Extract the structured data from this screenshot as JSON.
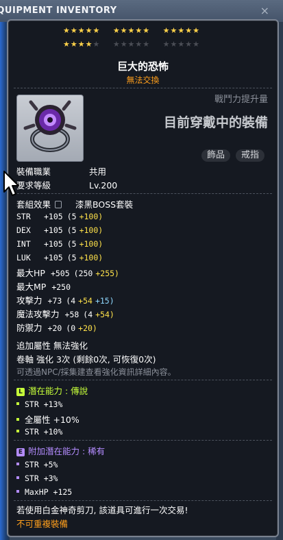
{
  "window": {
    "title": "EQUIPMENT INVENTORY",
    "close_glyph": "×"
  },
  "stars": {
    "row1": [
      "★★★★★",
      "★★★★★",
      "★★★★★"
    ],
    "row2_on": "★★★★",
    "row2_off": [
      "★",
      "★★★★★",
      "★★★★★"
    ]
  },
  "item": {
    "name": "巨大的恐怖",
    "trade_status": "無法交換",
    "icon": "ring-icon",
    "power_label": "戰鬥力提升量",
    "equipped_label": "目前穿戴中的裝備",
    "tags": [
      "飾品",
      "戒指"
    ]
  },
  "requirements": {
    "job_label": "裝備職業",
    "job_value": "共用",
    "level_label": "要求等級",
    "level_value": "Lv.200"
  },
  "set": {
    "label": "套組效果",
    "name": "漆黑BOSS套裝"
  },
  "stats": [
    {
      "name": "STR",
      "total": "+105",
      "base": "(5",
      "bonus": "+100)"
    },
    {
      "name": "DEX",
      "total": "+105",
      "base": "(5",
      "bonus": "+100)"
    },
    {
      "name": "INT",
      "total": "+105",
      "base": "(5",
      "bonus": "+100)"
    },
    {
      "name": "LUK",
      "total": "+105",
      "base": "(5",
      "bonus": "+100)"
    },
    {
      "name": "最大HP",
      "total": "+505",
      "base": "(250",
      "bonus": "+255)"
    },
    {
      "name": "最大MP",
      "total": "+250",
      "base": "",
      "bonus": ""
    },
    {
      "name": "攻擊力",
      "total": "+73",
      "base": "(4",
      "bonus": "+54",
      "extra": "+15)"
    },
    {
      "name": "魔法攻擊力",
      "total": "+58",
      "base": "(4",
      "bonus": "+54)"
    },
    {
      "name": "防禦力",
      "total": "+20",
      "base": "(0",
      "bonus": "+20)"
    }
  ],
  "upgrade": {
    "extra_stat_label": "追加屬性",
    "extra_stat_value": "無法強化",
    "scroll_line": "卷軸 強化 3次 (剩餘0次, 可恢復0次)",
    "hint": "可透過NPC/採集建查看強化資訊詳細內容。"
  },
  "potential": {
    "badge": "L",
    "label": "潛在能力 : ",
    "grade": "傳說",
    "lines": [
      "STR +13%",
      "全屬性 +10%",
      "STR +10%"
    ]
  },
  "bonus_potential": {
    "badge": "E",
    "label": "附加潛在能力 : ",
    "grade": "稀有",
    "lines": [
      "STR +5%",
      "STR +3%",
      "MaxHP +125"
    ]
  },
  "footer": {
    "scissors_note": "若使用白金神奇剪刀, 該道具可進行一次交易!",
    "no_reequip": "不可重複裝備"
  }
}
